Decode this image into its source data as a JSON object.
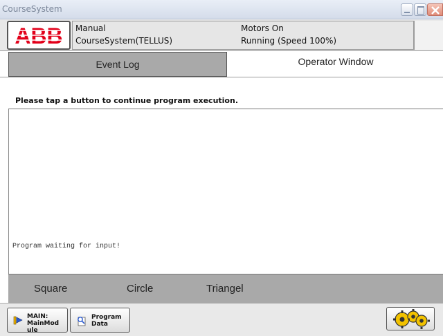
{
  "window": {
    "title": "CourseSystem"
  },
  "header": {
    "logo_text": "ABB",
    "mode": "Manual",
    "system_name": "CourseSystem(TELLUS)",
    "motors_state": "Motors On",
    "run_state": "Running (Speed 100%)"
  },
  "tabs": [
    {
      "label": "Event Log",
      "active": false
    },
    {
      "label": "Operator Window",
      "active": true
    }
  ],
  "operator": {
    "prompt": "Please tap a button to continue program execution.",
    "output_line": "Program waiting for input!"
  },
  "actions": [
    "Square",
    "Circle",
    "Triangel"
  ],
  "taskbar": {
    "main_label_line1": "MAIN:",
    "main_label_line2": "MainMod",
    "main_label_line3": "ule",
    "program_data_line1": "Program",
    "program_data_line2": "Data"
  },
  "colors": {
    "abb_red": "#e2001a"
  },
  "icons": [
    "minimize-icon",
    "maximize-icon",
    "close-icon",
    "program-pointer-icon",
    "program-data-icon",
    "gears-icon"
  ]
}
